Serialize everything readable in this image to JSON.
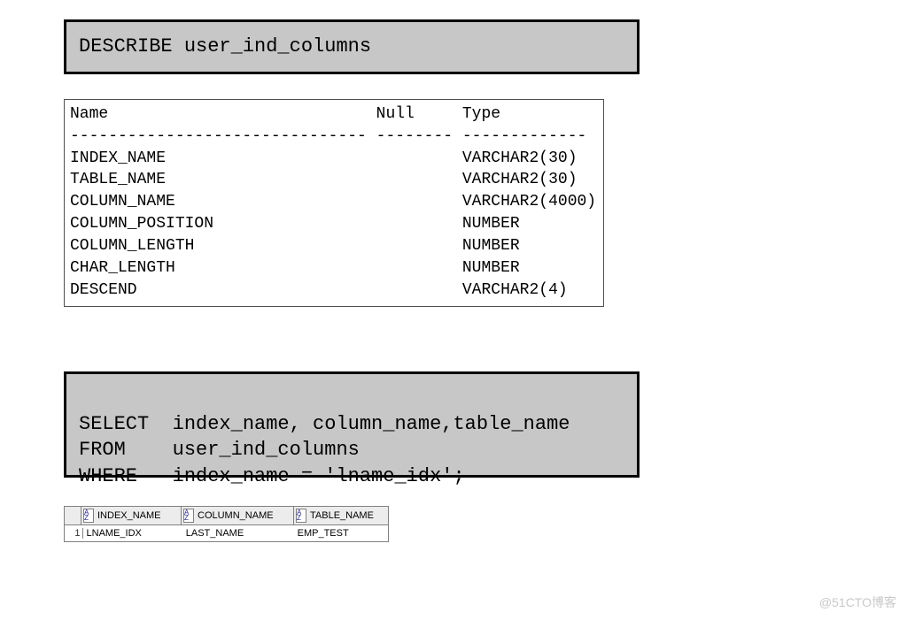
{
  "describe_stmt": "DESCRIBE user_ind_columns",
  "describe_output": {
    "headers": {
      "name": "Name",
      "null": "Null",
      "type": "Type"
    },
    "dash_name": "-------------------------------",
    "dash_null": "--------",
    "dash_type": "-------------",
    "rows": [
      {
        "name": "INDEX_NAME",
        "null": "",
        "type": "VARCHAR2(30)"
      },
      {
        "name": "TABLE_NAME",
        "null": "",
        "type": "VARCHAR2(30)"
      },
      {
        "name": "COLUMN_NAME",
        "null": "",
        "type": "VARCHAR2(4000)"
      },
      {
        "name": "COLUMN_POSITION",
        "null": "",
        "type": "NUMBER"
      },
      {
        "name": "COLUMN_LENGTH",
        "null": "",
        "type": "NUMBER"
      },
      {
        "name": "CHAR_LENGTH",
        "null": "",
        "type": "NUMBER"
      },
      {
        "name": "DESCEND",
        "null": "",
        "type": "VARCHAR2(4)"
      }
    ]
  },
  "select_stmt": {
    "line1": "SELECT  index_name, column_name,table_name",
    "line2": "FROM    user_ind_columns",
    "line3": "WHERE   index_name = 'lname_idx';"
  },
  "result": {
    "headers": [
      "INDEX_NAME",
      "COLUMN_NAME",
      "TABLE_NAME"
    ],
    "rows": [
      {
        "n": "1",
        "index_name": "LNAME_IDX",
        "column_name": "LAST_NAME",
        "table_name": "EMP_TEST"
      }
    ]
  },
  "sort_glyph": "A\nZ",
  "watermark": "@51CTO博客"
}
